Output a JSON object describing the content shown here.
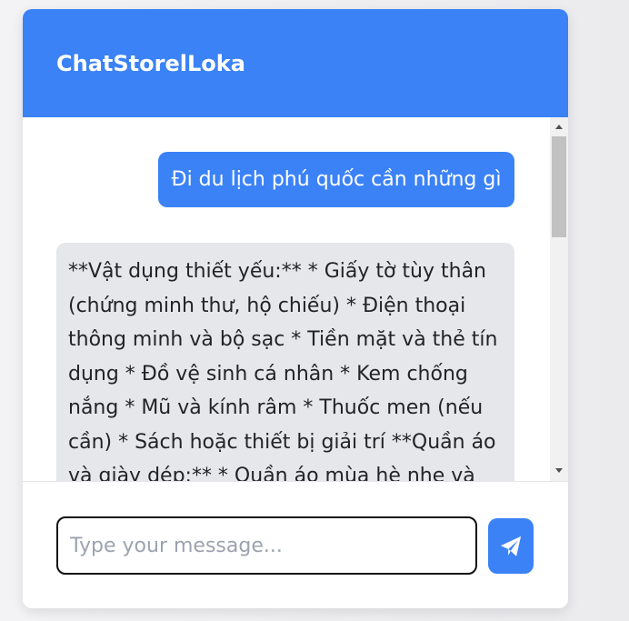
{
  "header": {
    "title": "ChatStorelLoka"
  },
  "messages": [
    {
      "role": "user",
      "text": "Đi du lịch phú quốc cần những gì"
    },
    {
      "role": "bot",
      "text": "**Vật dụng thiết yếu:** * Giấy tờ tùy thân (chứng minh thư, hộ chiếu) * Điện thoại thông minh và bộ sạc * Tiền mặt và thẻ tín dụng * Đồ vệ sinh cá nhân * Kem chống nắng * Mũ và kính râm * Thuốc men (nếu cần) * Sách hoặc thiết bị giải trí **Quần áo và giày dép:** * Quần áo mùa hè nhẹ và"
    }
  ],
  "composer": {
    "placeholder": "Type your message...",
    "value": ""
  },
  "send_button": {
    "icon": "paper-plane-icon"
  },
  "colors": {
    "accent": "#3b82f6",
    "bot_bubble": "#e5e7eb",
    "page_background": "#ebebed"
  }
}
